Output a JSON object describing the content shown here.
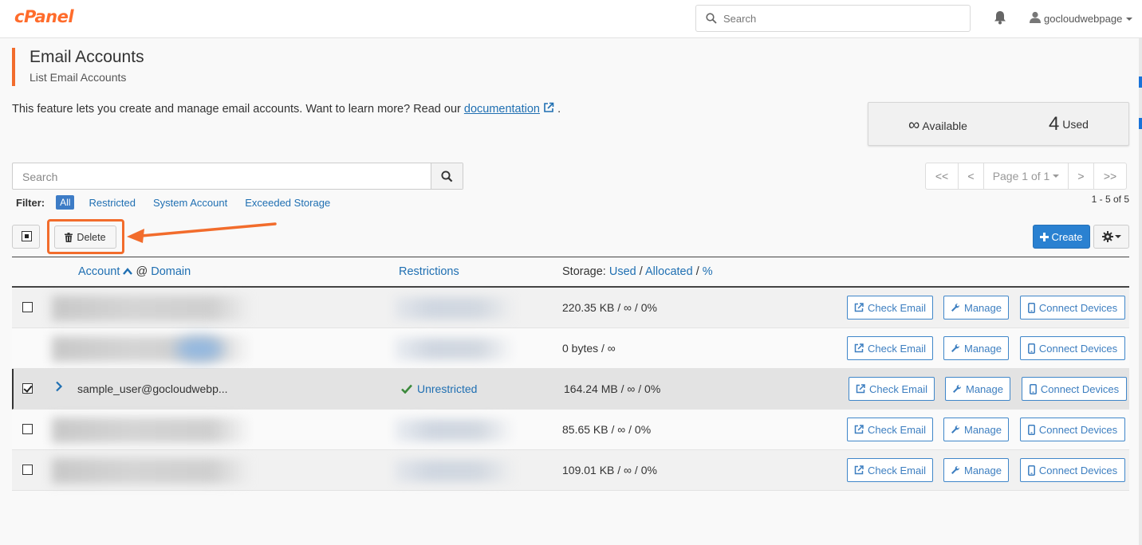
{
  "app": {
    "logo": "cPanel"
  },
  "topbar": {
    "search_placeholder": "Search",
    "username": "gocloudwebpage"
  },
  "page": {
    "title": "Email Accounts",
    "subtitle": "List Email Accounts",
    "intro_text": "This feature lets you create and manage email accounts. Want to learn more? Read our ",
    "intro_link": "documentation",
    "intro_end": "."
  },
  "stats": {
    "available_value": "∞",
    "available_label": "Available",
    "used_value": "4",
    "used_label": "Used"
  },
  "list": {
    "search_placeholder": "Search",
    "pager": {
      "first": "<<",
      "prev": "<",
      "page": "Page 1 of 1",
      "next": ">",
      "last": ">>"
    },
    "range": "1 - 5 of 5",
    "filter": {
      "label": "Filter:",
      "all": "All",
      "restricted": "Restricted",
      "system": "System Account",
      "exceeded": "Exceeded Storage"
    },
    "delete_label": "Delete",
    "create_label": "Create"
  },
  "table": {
    "headers": {
      "account": "Account",
      "at": "@",
      "domain": "Domain",
      "restrictions": "Restrictions",
      "storage": "Storage:",
      "used": "Used",
      "sep": "/",
      "allocated": "Allocated",
      "percent": "%"
    },
    "rows": [
      {
        "storage": "220.35 KB / ∞ / 0%"
      },
      {
        "storage": "0 bytes / ∞"
      },
      {
        "account": "sample_user@gocloudwebp...",
        "restriction": "Unrestricted",
        "storage": "164.24 MB / ∞ / 0%"
      },
      {
        "storage": "85.65 KB / ∞ / 0%"
      },
      {
        "storage": "109.01 KB / ∞ / 0%"
      }
    ],
    "actions": {
      "check": "Check Email",
      "manage": "Manage",
      "connect": "Connect Devices"
    }
  },
  "colors": {
    "brand": "#ff6c2c",
    "accent": "#2a81d1",
    "link": "#1f6fb2",
    "success": "#3c8a3c"
  }
}
